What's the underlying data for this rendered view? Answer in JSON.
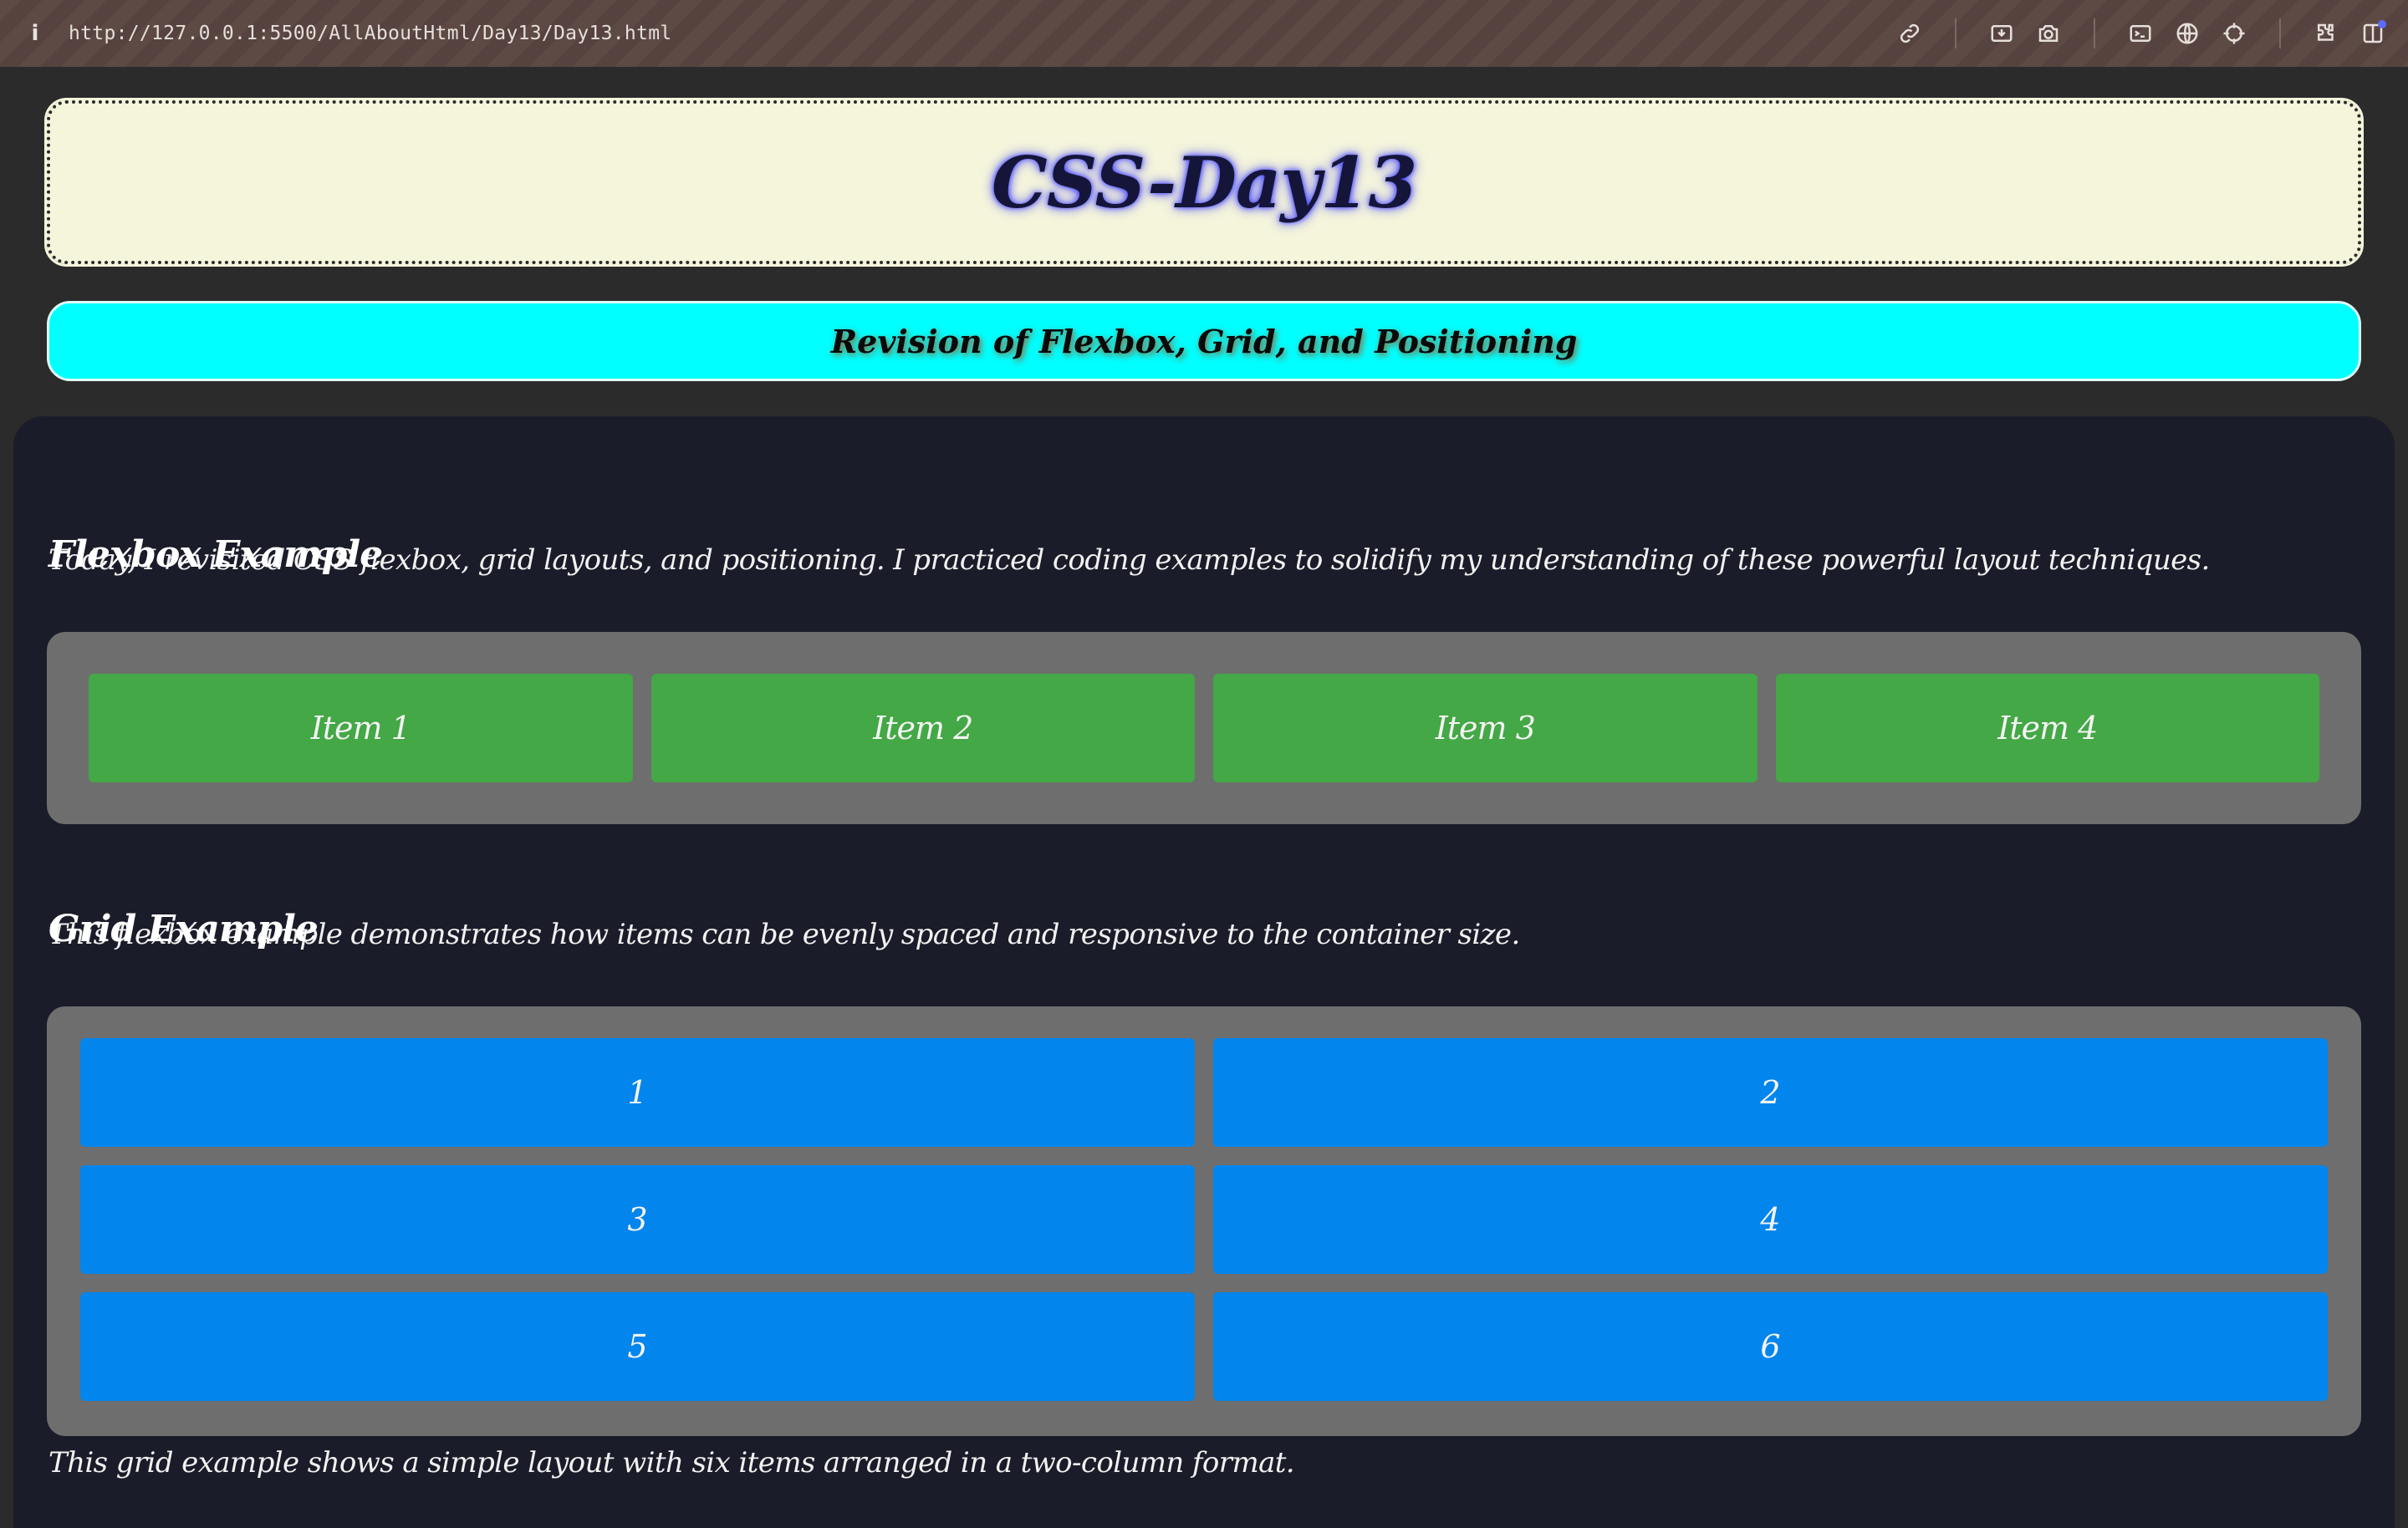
{
  "browser": {
    "info_icon": "i",
    "url": "http://127.0.0.1:5500/AllAboutHtml/Day13/Day13.html",
    "icons": [
      "link-icon",
      "screenshot-icon",
      "camera-icon",
      "terminal-icon",
      "globe-icon",
      "crosshair-icon",
      "extensions-icon",
      "sidebar-icon"
    ]
  },
  "header": {
    "title": "CSS-Day13"
  },
  "subheader": {
    "title": "Revision of Flexbox, Grid, and Positioning"
  },
  "content": {
    "intro": "Today, I revisited CSS flexbox, grid layouts, and positioning. I practiced coding examples to solidify my understanding of these powerful layout techniques.",
    "flexbox": {
      "heading": "Flexbox Example",
      "items": [
        "Item 1",
        "Item 2",
        "Item 3",
        "Item 4"
      ],
      "description": "This flexbox example demonstrates how items can be evenly spaced and responsive to the container size."
    },
    "grid": {
      "heading": "Grid Example",
      "items": [
        "1",
        "2",
        "3",
        "4",
        "5",
        "6"
      ],
      "description": "This grid example shows a simple layout with six items arranged in a two-column format."
    }
  },
  "colors": {
    "header_bg": "#f5f5dc",
    "subheader_bg": "#00ffff",
    "content_bg": "#1b1c29",
    "flex_item": "#43a845",
    "grid_item": "#0285ed",
    "container_bg": "#6e6e6e"
  }
}
